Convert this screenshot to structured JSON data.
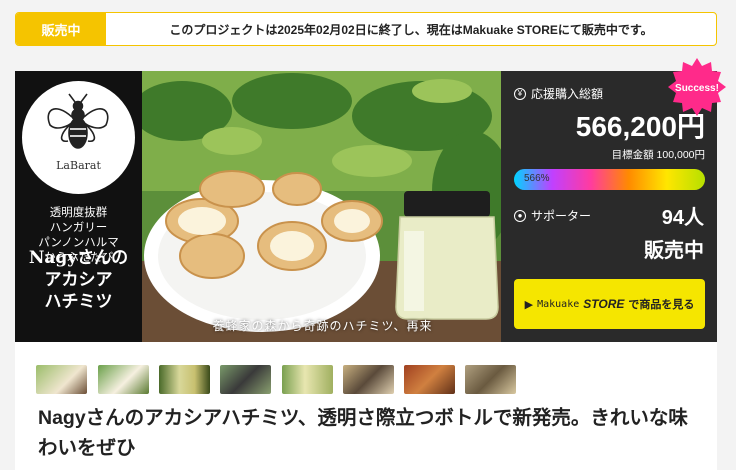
{
  "status": {
    "badge": "販売中",
    "message": "このプロジェクトは2025年02月02日に終了し、現在はMakuake STOREにて販売中です。"
  },
  "hero": {
    "logo_text": "LaBarat",
    "tagline_lines": [
      "透明度抜群",
      "ハンガリー",
      "パンノンハルマ",
      "からふたたび"
    ],
    "product_lines": [
      "Nagyさんの",
      "アカシア",
      "ハチミツ"
    ],
    "caption": "養蜂家の森から奇跡のハチミツ、再来"
  },
  "stats": {
    "total_label": "応援購入総額",
    "amount": "566,200円",
    "goal": "目標金額 100,000円",
    "progress_text": "566%",
    "progress_fraction": 1.0,
    "supporters_label": "サポーター",
    "supporters_count": "94人",
    "sale_status": "販売中",
    "store_button": {
      "brand": "Makuake",
      "brand_store": "STORE",
      "label": "で商品を見る"
    },
    "success_badge": "Success!"
  },
  "thumbnails": [
    "thumb-1",
    "thumb-2",
    "thumb-3",
    "thumb-4",
    "thumb-5",
    "thumb-6",
    "thumb-7",
    "thumb-8"
  ],
  "title": "Nagyさんのアカシアハチミツ、透明さ際立つボトルで新発売。きれいな味わいをぜひ",
  "colors": {
    "accent_yellow": "#f5c400",
    "store_yellow": "#f5e600",
    "success_pink": "#ff2a8a",
    "panel_dark": "#2a2a2a"
  }
}
